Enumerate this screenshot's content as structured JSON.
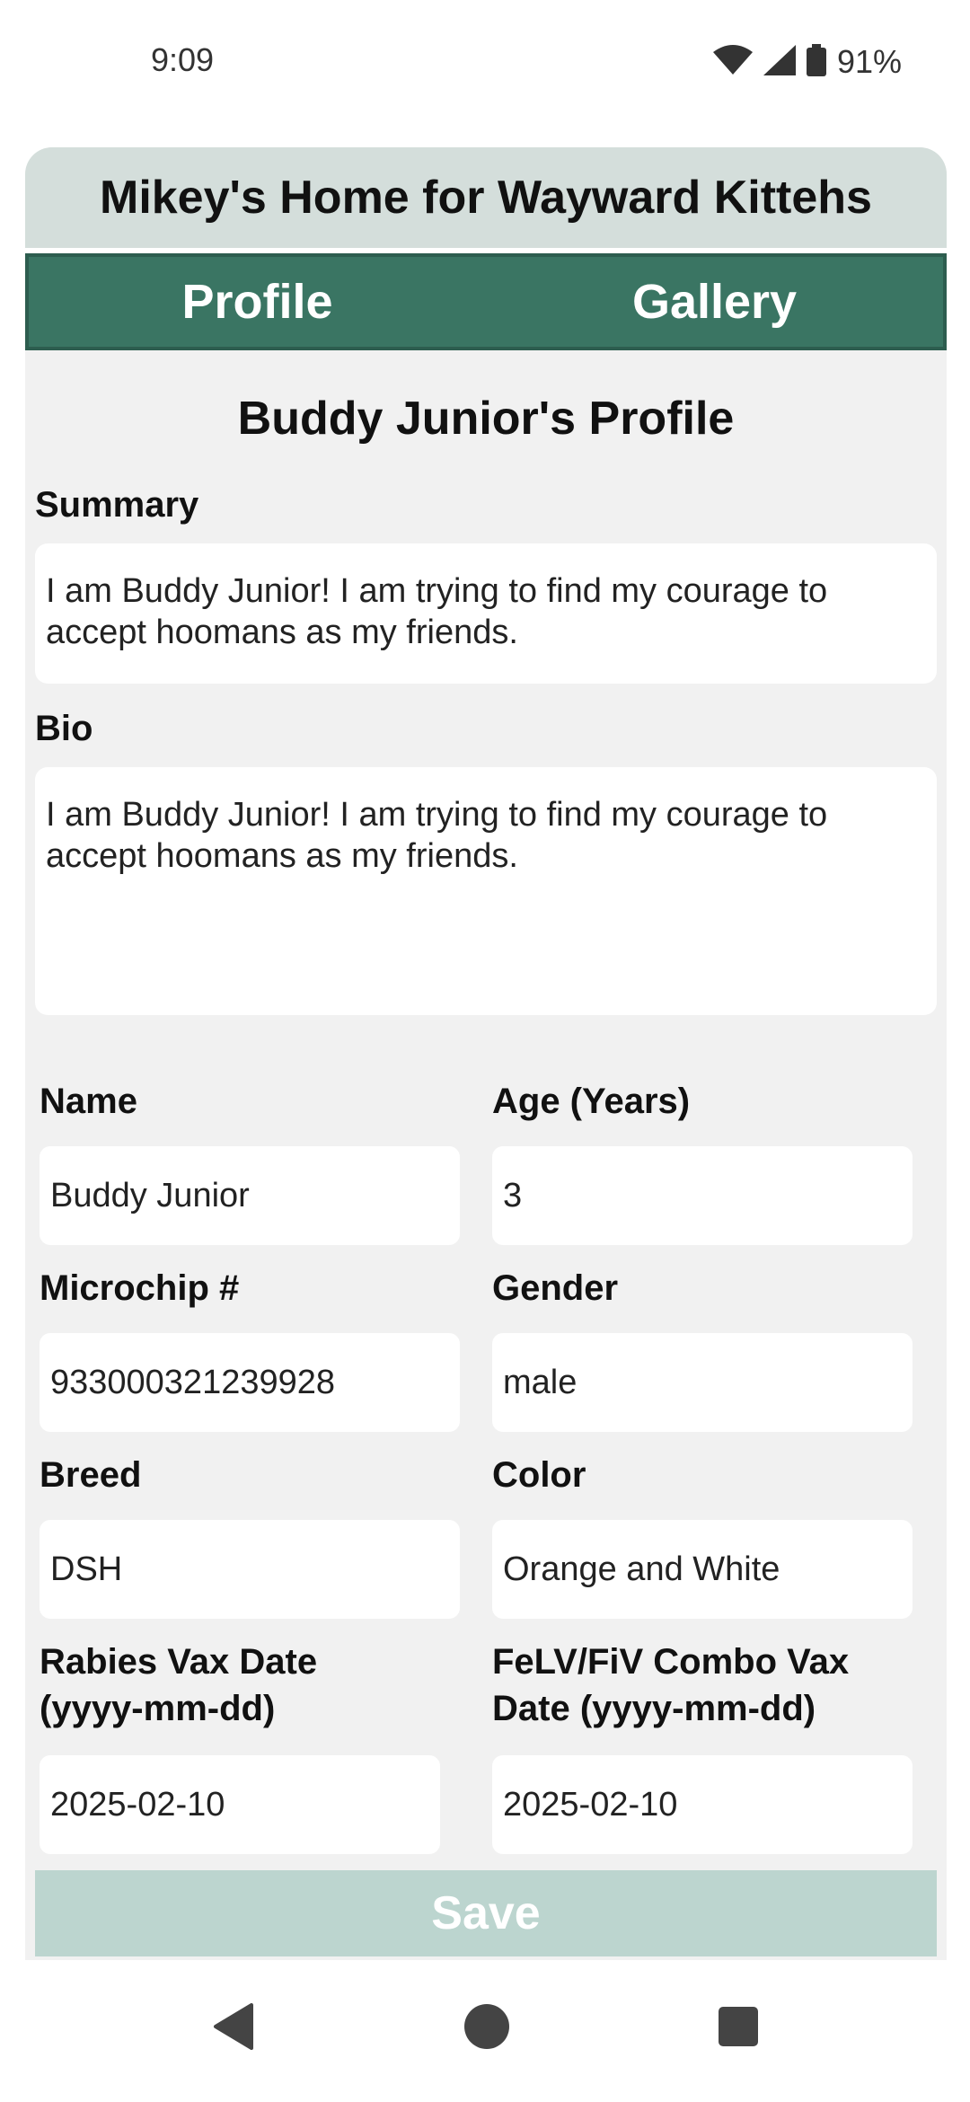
{
  "status_bar": {
    "time": "9:09",
    "battery": "91%",
    "icons": [
      "wifi-icon",
      "cell-signal-icon",
      "battery-icon"
    ]
  },
  "app": {
    "title": "Mikey's Home for Wayward Kittehs",
    "tabs": [
      {
        "label": "Profile"
      },
      {
        "label": "Gallery"
      }
    ],
    "accent_color": "#3a7563"
  },
  "profile": {
    "page_title": "Buddy Junior's Profile",
    "summary_label": "Summary",
    "summary_value": "I am Buddy Junior! I am trying to find my courage to accept hoomans as my friends.",
    "bio_label": "Bio",
    "bio_value": "I am Buddy Junior! I am trying to find my courage to accept hoomans as my friends.",
    "fields": {
      "name": {
        "label": "Name",
        "value": "Buddy Junior"
      },
      "age": {
        "label": "Age (Years)",
        "value": "3"
      },
      "microchip": {
        "label": "Microchip #",
        "value": "933000321239928"
      },
      "gender": {
        "label": "Gender",
        "value": "male"
      },
      "breed": {
        "label": "Breed",
        "value": "DSH"
      },
      "color": {
        "label": "Color",
        "value": "Orange and White"
      },
      "rabies": {
        "label": "Rabies Vax Date (yyyy-mm-dd)",
        "value": "2025-02-10"
      },
      "felv": {
        "label": "FeLV/FiV Combo Vax Date (yyyy-mm-dd)",
        "value": "2025-02-10"
      }
    },
    "save_label": "Save"
  },
  "nav_bar": {
    "icons": [
      "back-icon",
      "home-icon",
      "recents-icon"
    ]
  }
}
